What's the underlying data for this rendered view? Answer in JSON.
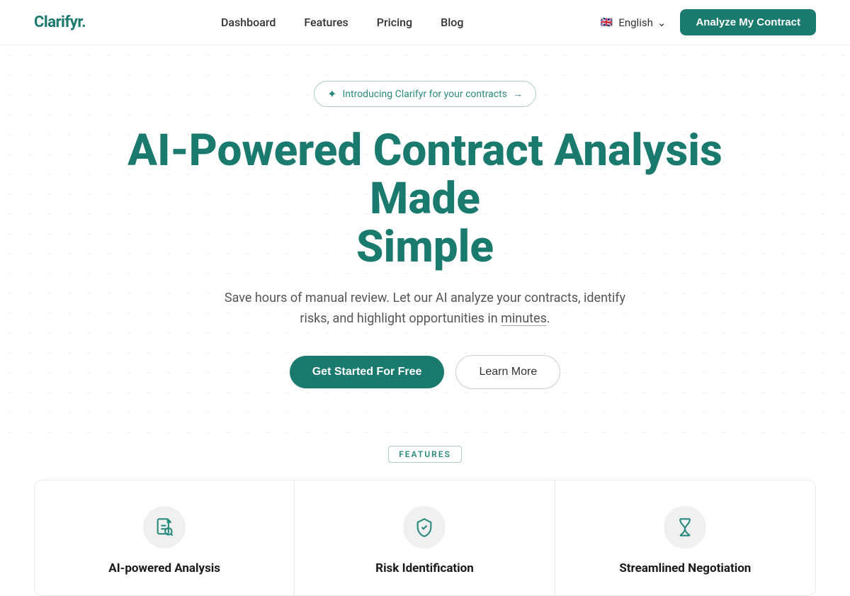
{
  "navbar": {
    "logo": "Clarifyr.",
    "links": [
      {
        "label": "Dashboard",
        "href": "#"
      },
      {
        "label": "Features",
        "href": "#"
      },
      {
        "label": "Pricing",
        "href": "#"
      },
      {
        "label": "Blog",
        "href": "#"
      }
    ],
    "language": "English",
    "cta_label": "Analyze My Contract"
  },
  "hero": {
    "badge_text": "Introducing Clarifyr for your contracts",
    "title_line1": "AI-Powered Contract Analysis Made",
    "title_line2": "Simple",
    "subtitle": "Save hours of manual review. Let our AI analyze your contracts, identify risks, and highlight opportunities in minutes.",
    "underline_word": "minutes",
    "btn_primary": "Get Started For Free",
    "btn_secondary": "Learn More"
  },
  "features": {
    "section_label": "FEATURES",
    "cards": [
      {
        "icon": "document",
        "title": "AI-powered Analysis"
      },
      {
        "icon": "shield",
        "title": "Risk Identification"
      },
      {
        "icon": "hourglass",
        "title": "Streamlined Negotiation"
      }
    ]
  }
}
